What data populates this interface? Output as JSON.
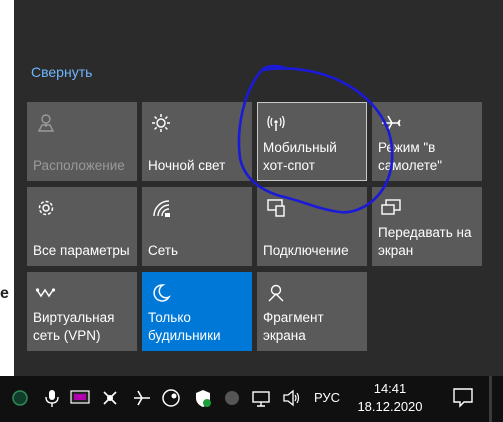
{
  "background_peek_text": "e",
  "collapse_label": "Свернуть",
  "tiles": [
    {
      "label": "Расположение",
      "icon": "location-icon",
      "state": "disabled"
    },
    {
      "label": "Ночной свет",
      "icon": "brightness-icon",
      "state": "normal"
    },
    {
      "label": "Мобильный хот-спот",
      "icon": "hotspot-icon",
      "state": "highlighted"
    },
    {
      "label": "Режим \"в самолете\"",
      "icon": "airplane-icon",
      "state": "normal"
    },
    {
      "label": "Все параметры",
      "icon": "gear-icon",
      "state": "normal"
    },
    {
      "label": "Сеть",
      "icon": "network-icon",
      "state": "normal"
    },
    {
      "label": "Подключение",
      "icon": "connect-icon",
      "state": "normal"
    },
    {
      "label": "Передавать на экран",
      "icon": "project-icon",
      "state": "normal"
    },
    {
      "label": "Виртуальная сеть (VPN)",
      "icon": "vpn-icon",
      "state": "normal"
    },
    {
      "label": "Только будильники",
      "icon": "moon-icon",
      "state": "active"
    },
    {
      "label": "Фрагмент экрана",
      "icon": "snip-icon",
      "state": "normal"
    }
  ],
  "taskbar": {
    "language": "РУС",
    "time": "14:41",
    "date": "18.12.2020"
  },
  "colors": {
    "panel_bg": "#2b2b2b",
    "tile_bg": "#5a5a5a",
    "accent": "#0078d7",
    "link": "#6fb6ff",
    "annotation": "#1a1ad8"
  }
}
